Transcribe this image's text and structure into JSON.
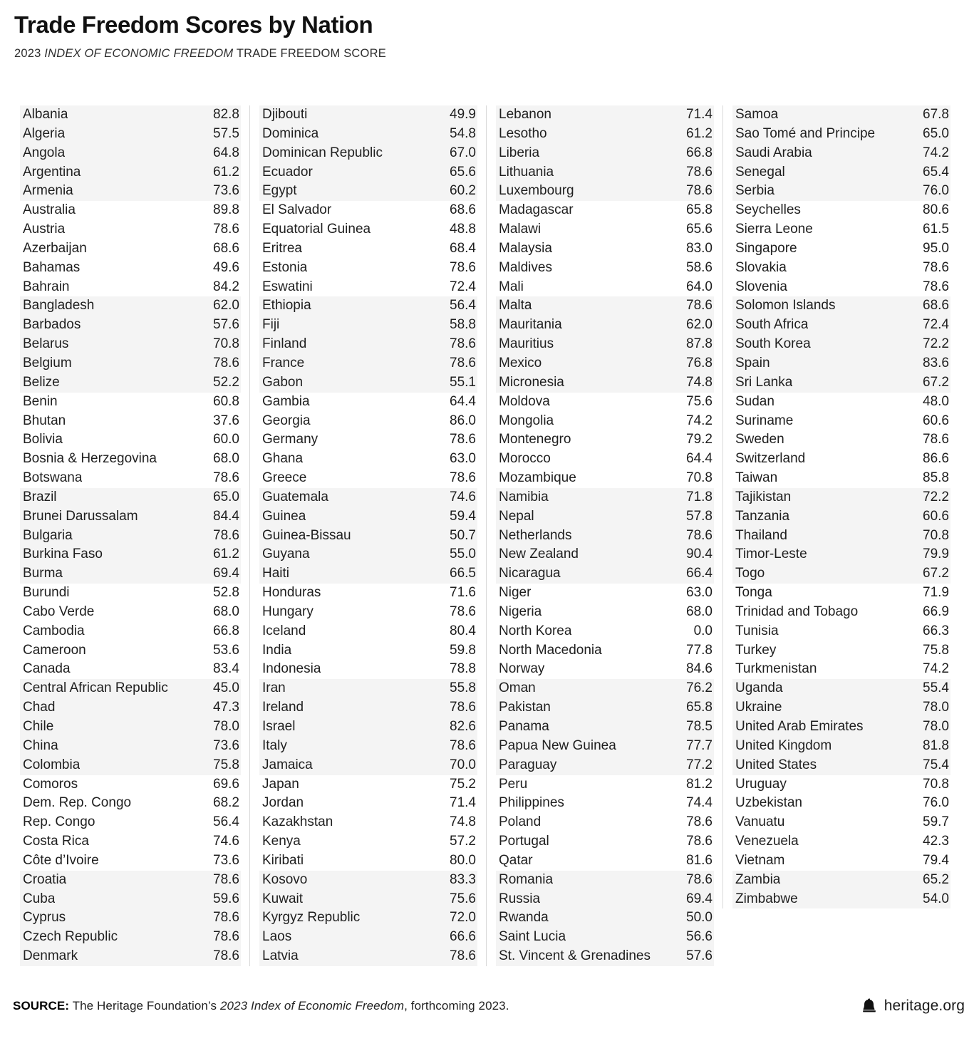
{
  "header": {
    "title": "Trade Freedom Scores by Nation",
    "subtitle_pre": "2023 ",
    "subtitle_italic": "INDEX OF ECONOMIC FREEDOM",
    "subtitle_post": " TRADE FREEDOM SCORE"
  },
  "footer": {
    "source_label": "SOURCE:",
    "source_pre": " The Heritage Foundation’s ",
    "source_italic": "2023 Index of Economic Freedom",
    "source_post": ", forthcoming 2023.",
    "brand_icon": "liberty-bell-icon",
    "brand_text": "heritage.org"
  },
  "colors": {
    "row_shade": "#f4f4f4",
    "divider": "#d8d8d8",
    "text": "#1f1f1f"
  },
  "chart_data": {
    "type": "table",
    "title": "Trade Freedom Scores by Nation",
    "subtitle": "2023 INDEX OF ECONOMIC FREEDOM TRADE FREEDOM SCORE",
    "columns": [
      "Nation",
      "Trade Freedom Score"
    ],
    "shade_group_size": 5,
    "value_range": [
      0.0,
      95.0
    ],
    "source": "The Heritage Foundation’s 2023 Index of Economic Freedom, forthcoming 2023."
  },
  "columns": [
    {
      "id": "column-1",
      "rows": [
        {
          "name": "Albania",
          "score": "82.8"
        },
        {
          "name": "Algeria",
          "score": "57.5"
        },
        {
          "name": "Angola",
          "score": "64.8"
        },
        {
          "name": "Argentina",
          "score": "61.2"
        },
        {
          "name": "Armenia",
          "score": "73.6"
        },
        {
          "name": "Australia",
          "score": "89.8"
        },
        {
          "name": "Austria",
          "score": "78.6"
        },
        {
          "name": "Azerbaijan",
          "score": "68.6"
        },
        {
          "name": "Bahamas",
          "score": "49.6"
        },
        {
          "name": "Bahrain",
          "score": "84.2"
        },
        {
          "name": "Bangladesh",
          "score": "62.0"
        },
        {
          "name": "Barbados",
          "score": "57.6"
        },
        {
          "name": "Belarus",
          "score": "70.8"
        },
        {
          "name": "Belgium",
          "score": "78.6"
        },
        {
          "name": "Belize",
          "score": "52.2"
        },
        {
          "name": "Benin",
          "score": "60.8"
        },
        {
          "name": "Bhutan",
          "score": "37.6"
        },
        {
          "name": "Bolivia",
          "score": "60.0"
        },
        {
          "name": "Bosnia & Herzegovina",
          "score": "68.0"
        },
        {
          "name": "Botswana",
          "score": "78.6"
        },
        {
          "name": "Brazil",
          "score": "65.0"
        },
        {
          "name": "Brunei Darussalam",
          "score": "84.4"
        },
        {
          "name": "Bulgaria",
          "score": "78.6"
        },
        {
          "name": "Burkina Faso",
          "score": "61.2"
        },
        {
          "name": "Burma",
          "score": "69.4"
        },
        {
          "name": "Burundi",
          "score": "52.8"
        },
        {
          "name": "Cabo Verde",
          "score": "68.0"
        },
        {
          "name": "Cambodia",
          "score": "66.8"
        },
        {
          "name": "Cameroon",
          "score": "53.6"
        },
        {
          "name": "Canada",
          "score": "83.4"
        },
        {
          "name": "Central African Republic",
          "score": "45.0"
        },
        {
          "name": "Chad",
          "score": "47.3"
        },
        {
          "name": "Chile",
          "score": "78.0"
        },
        {
          "name": "China",
          "score": "73.6"
        },
        {
          "name": "Colombia",
          "score": "75.8"
        },
        {
          "name": "Comoros",
          "score": "69.6"
        },
        {
          "name": "Dem. Rep. Congo",
          "score": "68.2"
        },
        {
          "name": "Rep. Congo",
          "score": "56.4"
        },
        {
          "name": "Costa Rica",
          "score": "74.6"
        },
        {
          "name": "Côte d’Ivoire",
          "score": "73.6"
        },
        {
          "name": "Croatia",
          "score": "78.6"
        },
        {
          "name": "Cuba",
          "score": "59.6"
        },
        {
          "name": "Cyprus",
          "score": "78.6"
        },
        {
          "name": "Czech Republic",
          "score": "78.6"
        },
        {
          "name": "Denmark",
          "score": "78.6"
        }
      ]
    },
    {
      "id": "column-2",
      "rows": [
        {
          "name": "Djibouti",
          "score": "49.9"
        },
        {
          "name": "Dominica",
          "score": "54.8"
        },
        {
          "name": "Dominican Republic",
          "score": "67.0"
        },
        {
          "name": "Ecuador",
          "score": "65.6"
        },
        {
          "name": "Egypt",
          "score": "60.2"
        },
        {
          "name": "El Salvador",
          "score": "68.6"
        },
        {
          "name": "Equatorial Guinea",
          "score": "48.8"
        },
        {
          "name": "Eritrea",
          "score": "68.4"
        },
        {
          "name": "Estonia",
          "score": "78.6"
        },
        {
          "name": "Eswatini",
          "score": "72.4"
        },
        {
          "name": "Ethiopia",
          "score": "56.4"
        },
        {
          "name": "Fiji",
          "score": "58.8"
        },
        {
          "name": "Finland",
          "score": "78.6"
        },
        {
          "name": "France",
          "score": "78.6"
        },
        {
          "name": "Gabon",
          "score": "55.1"
        },
        {
          "name": "Gambia",
          "score": "64.4"
        },
        {
          "name": "Georgia",
          "score": "86.0"
        },
        {
          "name": "Germany",
          "score": "78.6"
        },
        {
          "name": "Ghana",
          "score": "63.0"
        },
        {
          "name": "Greece",
          "score": "78.6"
        },
        {
          "name": "Guatemala",
          "score": "74.6"
        },
        {
          "name": "Guinea",
          "score": "59.4"
        },
        {
          "name": "Guinea-Bissau",
          "score": "50.7"
        },
        {
          "name": "Guyana",
          "score": "55.0"
        },
        {
          "name": "Haiti",
          "score": "66.5"
        },
        {
          "name": "Honduras",
          "score": "71.6"
        },
        {
          "name": "Hungary",
          "score": "78.6"
        },
        {
          "name": "Iceland",
          "score": "80.4"
        },
        {
          "name": "India",
          "score": "59.8"
        },
        {
          "name": "Indonesia",
          "score": "78.8"
        },
        {
          "name": "Iran",
          "score": "55.8"
        },
        {
          "name": "Ireland",
          "score": "78.6"
        },
        {
          "name": "Israel",
          "score": "82.6"
        },
        {
          "name": "Italy",
          "score": "78.6"
        },
        {
          "name": "Jamaica",
          "score": "70.0"
        },
        {
          "name": "Japan",
          "score": "75.2"
        },
        {
          "name": "Jordan",
          "score": "71.4"
        },
        {
          "name": "Kazakhstan",
          "score": "74.8"
        },
        {
          "name": "Kenya",
          "score": "57.2"
        },
        {
          "name": "Kiribati",
          "score": "80.0"
        },
        {
          "name": "Kosovo",
          "score": "83.3"
        },
        {
          "name": "Kuwait",
          "score": "75.6"
        },
        {
          "name": "Kyrgyz Republic",
          "score": "72.0"
        },
        {
          "name": "Laos",
          "score": "66.6"
        },
        {
          "name": "Latvia",
          "score": "78.6"
        }
      ]
    },
    {
      "id": "column-3",
      "rows": [
        {
          "name": "Lebanon",
          "score": "71.4"
        },
        {
          "name": "Lesotho",
          "score": "61.2"
        },
        {
          "name": "Liberia",
          "score": "66.8"
        },
        {
          "name": "Lithuania",
          "score": "78.6"
        },
        {
          "name": "Luxembourg",
          "score": "78.6"
        },
        {
          "name": "Madagascar",
          "score": "65.8"
        },
        {
          "name": "Malawi",
          "score": "65.6"
        },
        {
          "name": "Malaysia",
          "score": "83.0"
        },
        {
          "name": "Maldives",
          "score": "58.6"
        },
        {
          "name": "Mali",
          "score": "64.0"
        },
        {
          "name": "Malta",
          "score": "78.6"
        },
        {
          "name": "Mauritania",
          "score": "62.0"
        },
        {
          "name": "Mauritius",
          "score": "87.8"
        },
        {
          "name": "Mexico",
          "score": "76.8"
        },
        {
          "name": "Micronesia",
          "score": "74.8"
        },
        {
          "name": "Moldova",
          "score": "75.6"
        },
        {
          "name": "Mongolia",
          "score": "74.2"
        },
        {
          "name": "Montenegro",
          "score": "79.2"
        },
        {
          "name": "Morocco",
          "score": "64.4"
        },
        {
          "name": "Mozambique",
          "score": "70.8"
        },
        {
          "name": "Namibia",
          "score": "71.8"
        },
        {
          "name": "Nepal",
          "score": "57.8"
        },
        {
          "name": "Netherlands",
          "score": "78.6"
        },
        {
          "name": "New Zealand",
          "score": "90.4"
        },
        {
          "name": "Nicaragua",
          "score": "66.4"
        },
        {
          "name": "Niger",
          "score": "63.0"
        },
        {
          "name": "Nigeria",
          "score": "68.0"
        },
        {
          "name": "North Korea",
          "score": "0.0"
        },
        {
          "name": "North Macedonia",
          "score": "77.8"
        },
        {
          "name": "Norway",
          "score": "84.6"
        },
        {
          "name": "Oman",
          "score": "76.2"
        },
        {
          "name": "Pakistan",
          "score": "65.8"
        },
        {
          "name": "Panama",
          "score": "78.5"
        },
        {
          "name": "Papua New Guinea",
          "score": "77.7"
        },
        {
          "name": "Paraguay",
          "score": "77.2"
        },
        {
          "name": "Peru",
          "score": "81.2"
        },
        {
          "name": "Philippines",
          "score": "74.4"
        },
        {
          "name": "Poland",
          "score": "78.6"
        },
        {
          "name": "Portugal",
          "score": "78.6"
        },
        {
          "name": "Qatar",
          "score": "81.6"
        },
        {
          "name": "Romania",
          "score": "78.6"
        },
        {
          "name": "Russia",
          "score": "69.4"
        },
        {
          "name": "Rwanda",
          "score": "50.0"
        },
        {
          "name": "Saint Lucia",
          "score": "56.6"
        },
        {
          "name": "St. Vincent & Grenadines",
          "score": "57.6"
        }
      ]
    },
    {
      "id": "column-4",
      "rows": [
        {
          "name": "Samoa",
          "score": "67.8"
        },
        {
          "name": "Sao Tomé and Principe",
          "score": "65.0"
        },
        {
          "name": "Saudi Arabia",
          "score": "74.2"
        },
        {
          "name": "Senegal",
          "score": "65.4"
        },
        {
          "name": "Serbia",
          "score": "76.0"
        },
        {
          "name": "Seychelles",
          "score": "80.6"
        },
        {
          "name": "Sierra Leone",
          "score": "61.5"
        },
        {
          "name": "Singapore",
          "score": "95.0"
        },
        {
          "name": "Slovakia",
          "score": "78.6"
        },
        {
          "name": "Slovenia",
          "score": "78.6"
        },
        {
          "name": "Solomon Islands",
          "score": "68.6"
        },
        {
          "name": "South Africa",
          "score": "72.4"
        },
        {
          "name": "South Korea",
          "score": "72.2"
        },
        {
          "name": "Spain",
          "score": "83.6"
        },
        {
          "name": "Sri Lanka",
          "score": "67.2"
        },
        {
          "name": "Sudan",
          "score": "48.0"
        },
        {
          "name": "Suriname",
          "score": "60.6"
        },
        {
          "name": "Sweden",
          "score": "78.6"
        },
        {
          "name": "Switzerland",
          "score": "86.6"
        },
        {
          "name": "Taiwan",
          "score": "85.8"
        },
        {
          "name": "Tajikistan",
          "score": "72.2"
        },
        {
          "name": "Tanzania",
          "score": "60.6"
        },
        {
          "name": "Thailand",
          "score": "70.8"
        },
        {
          "name": "Timor-Leste",
          "score": "79.9"
        },
        {
          "name": "Togo",
          "score": "67.2"
        },
        {
          "name": "Tonga",
          "score": "71.9"
        },
        {
          "name": "Trinidad and Tobago",
          "score": "66.9"
        },
        {
          "name": "Tunisia",
          "score": "66.3"
        },
        {
          "name": "Turkey",
          "score": "75.8"
        },
        {
          "name": "Turkmenistan",
          "score": "74.2"
        },
        {
          "name": "Uganda",
          "score": "55.4"
        },
        {
          "name": "Ukraine",
          "score": "78.0"
        },
        {
          "name": "United Arab Emirates",
          "score": "78.0"
        },
        {
          "name": "United Kingdom",
          "score": "81.8"
        },
        {
          "name": "United States",
          "score": "75.4"
        },
        {
          "name": "Uruguay",
          "score": "70.8"
        },
        {
          "name": "Uzbekistan",
          "score": "76.0"
        },
        {
          "name": "Vanuatu",
          "score": "59.7"
        },
        {
          "name": "Venezuela",
          "score": "42.3"
        },
        {
          "name": "Vietnam",
          "score": "79.4"
        },
        {
          "name": "Zambia",
          "score": "65.2"
        },
        {
          "name": "Zimbabwe",
          "score": "54.0"
        }
      ]
    }
  ]
}
